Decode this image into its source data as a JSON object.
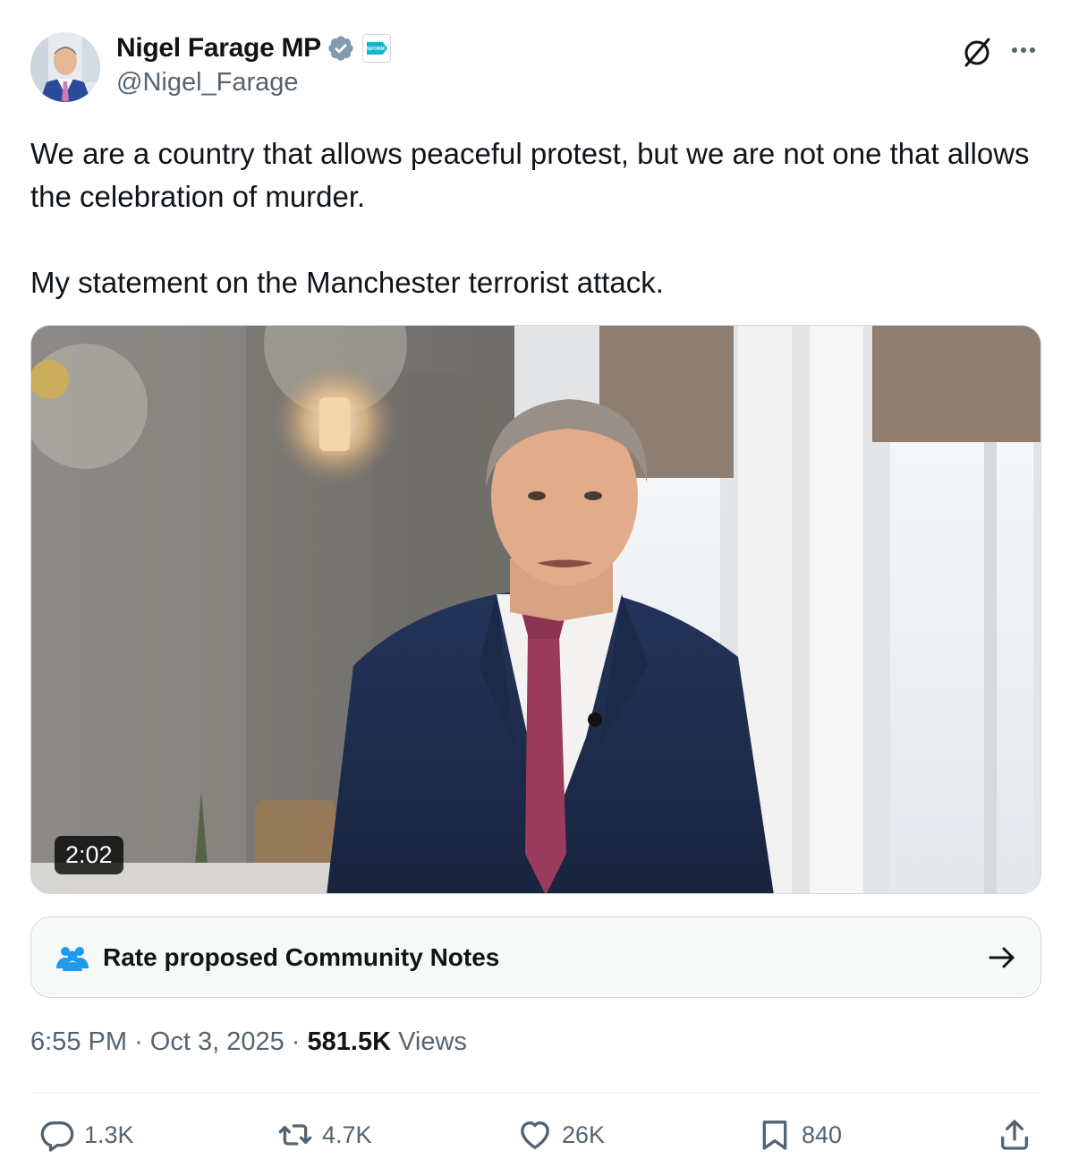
{
  "author": {
    "display_name": "Nigel Farage MP",
    "handle": "@Nigel_Farage",
    "affiliate_badge_text": "REFORM UK"
  },
  "tweet": {
    "text_line1": "We are a country that allows peaceful protest, but we are not one that allows the celebration of murder.",
    "text_line2": "My statement on the Manchester terrorist attack."
  },
  "media": {
    "duration": "2:02"
  },
  "community_notes": {
    "label": "Rate proposed Community Notes"
  },
  "meta": {
    "time": "6:55 PM",
    "date": "Oct 3, 2025",
    "views_count": "581.5K",
    "views_label": "Views",
    "separator": "·"
  },
  "actions": {
    "replies": "1.3K",
    "reposts": "4.7K",
    "likes": "26K",
    "bookmarks": "840"
  },
  "colors": {
    "verified_blue": "#1d9bf0",
    "text_primary": "#0f1419",
    "text_secondary": "#536471",
    "border": "#cfd9de",
    "notes_bg": "#f7f9f9"
  }
}
